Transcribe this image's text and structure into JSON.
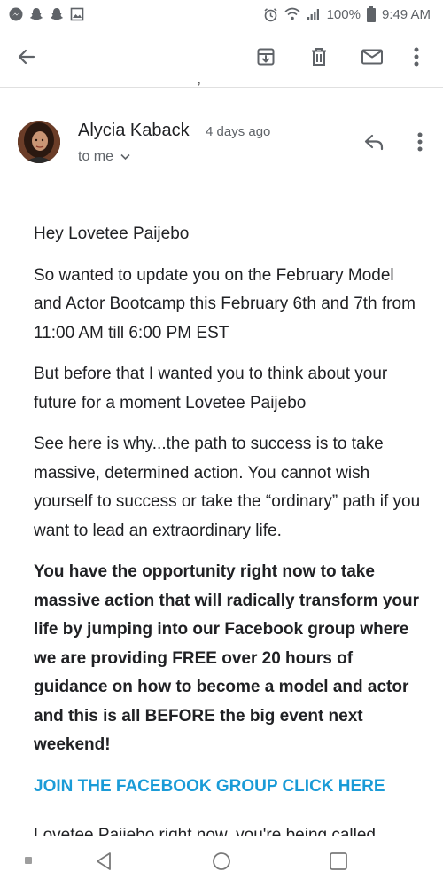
{
  "status_bar": {
    "battery": "100%",
    "time": "9:49 AM",
    "left_icons": [
      "messenger-icon",
      "snapchat-icon",
      "snapchat-icon",
      "gallery-icon"
    ],
    "right_icons": [
      "alarm-icon",
      "wifi-icon",
      "signal-icon",
      "battery-icon"
    ]
  },
  "toolbar": {
    "icons": [
      "back-arrow-icon",
      "archive-icon",
      "delete-icon",
      "mark-unread-icon",
      "more-vert-icon"
    ]
  },
  "message": {
    "sender_name": "Alycia Kaback",
    "time_ago": "4 days ago",
    "recipient_label": "to me",
    "greeting": "Hey Lovetee Paijebo",
    "p1": "So wanted to update you on the February Model and Actor Bootcamp this February 6th and 7th from 11:00 AM till 6:00 PM EST",
    "p2": "But before that I wanted you to think about your future for a moment Lovetee Paijebo",
    "p3": "See here is why...the path to success is to take massive, determined action. You cannot wish yourself to success or take the “ordinary” path if you want to lead an extraordinary life.",
    "p4_bold": "You have the opportunity right now to take massive action that will radically transform your life by jumping into our Facebook group where we are providing FREE over 20 hours of guidance on how to become a model and actor and this is all BEFORE the big event next weekend!",
    "link": "JOIN THE FACEBOOK GROUP CLICK HERE",
    "cut_line": "Lovetee Paijebo right now, you're being called"
  },
  "colors": {
    "link": "#1a9bd7",
    "icon": "#5f6368",
    "text": "#202124"
  }
}
